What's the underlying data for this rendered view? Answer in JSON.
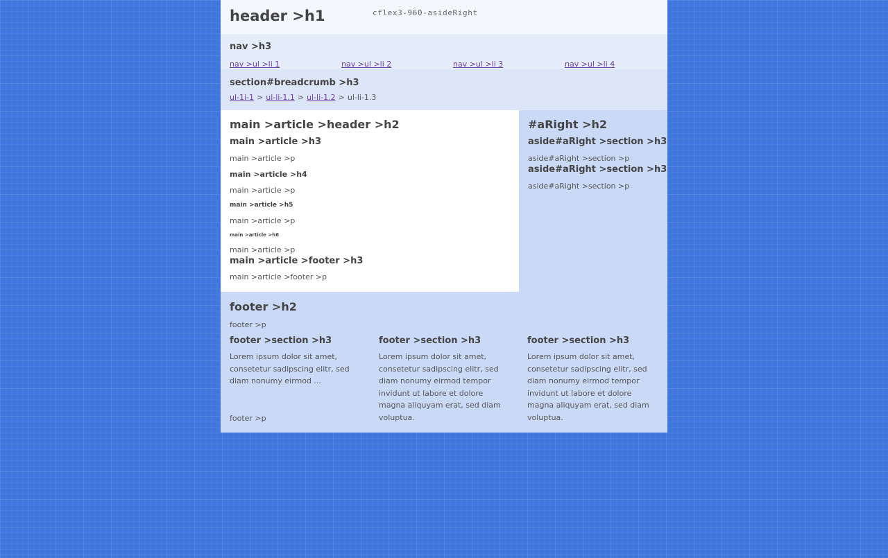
{
  "header": {
    "title": "header >h1",
    "tag": "cflex3-960-asideRight"
  },
  "nav": {
    "title": "nav >h3",
    "items": [
      "nav >ul >li 1",
      "nav >ul >li 2",
      "nav >ul >li 3",
      "nav >ul >li 4"
    ]
  },
  "breadcrumb": {
    "title": "section#breadcrumb >h3",
    "links": [
      "ul-1i-1",
      "ul-li-1.1",
      "ul-li-1.2"
    ],
    "separator": ">",
    "current": "ul-li-1.3"
  },
  "main": {
    "header_h2": "main >article >header >h2",
    "h3": "main >article >h3",
    "p1": "main >article >p",
    "h4": "main >article >h4",
    "p2": "main >article >p",
    "h5": "main >article >h5",
    "p3": "main >article >p",
    "h6": "main >article >h6",
    "p4": "main >article >p",
    "footer_h3": "main >article >footer >h3",
    "footer_p": "main >article >footer >p"
  },
  "aside": {
    "h2": "#aRight >h2",
    "s1_h3": "aside#aRight >section >h3",
    "s1_p": "aside#aRight >section >p",
    "s2_h3": "aside#aRight >section >h3",
    "s2_p": "aside#aRight >section >p"
  },
  "footer": {
    "h2": "footer >h2",
    "p_top": "footer >p",
    "sections": [
      {
        "h3": "footer >section >h3",
        "text": "Lorem ipsum dolor sit amet, consetetur sadipscing elitr, sed diam nonumy eirmod ..."
      },
      {
        "h3": "footer >section >h3",
        "text": "Lorem ipsum dolor sit amet, consetetur sadipscing elitr, sed diam nonumy eirmod tempor invidunt ut labore et dolore magna aliquyam erat, sed diam voluptua."
      },
      {
        "h3": "footer >section >h3",
        "text": "Lorem ipsum dolor sit amet, consetetur sadipscing elitr, sed diam nonumy eirmod tempor invidunt ut labore et dolore magna aliquyam erat, sed diam voluptua."
      }
    ],
    "p_bottom": "footer >p"
  },
  "colors": {
    "page_background": "#3f77dd",
    "link": "#6a3ea6",
    "header_bg": "#f4f7fd",
    "main_bg": "#ffffff",
    "aside_bg": "#c9d9f6"
  }
}
